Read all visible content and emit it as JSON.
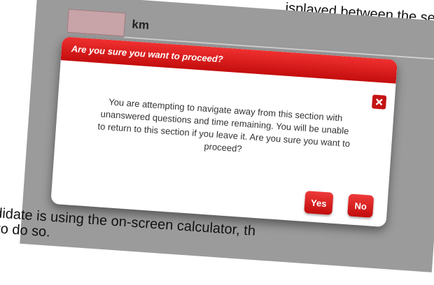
{
  "background": {
    "top_text": "isplayed between the se",
    "unit_label": "km",
    "bottom_line_1": "ndidate is using the on-screen calculator, th",
    "bottom_line_2": "y to do so."
  },
  "dialog": {
    "title": "Are you sure you want to proceed?",
    "message": "You are attempting to navigate away from this section with unanswered questions and time remaining. You will be unable to return to this section if you leave it.  Are you sure you want to proceed?",
    "yes_label": "Yes",
    "no_label": "No",
    "close_icon": "close-icon"
  },
  "colors": {
    "accent": "#d71a1a",
    "overlay": "#9b9b9b"
  }
}
